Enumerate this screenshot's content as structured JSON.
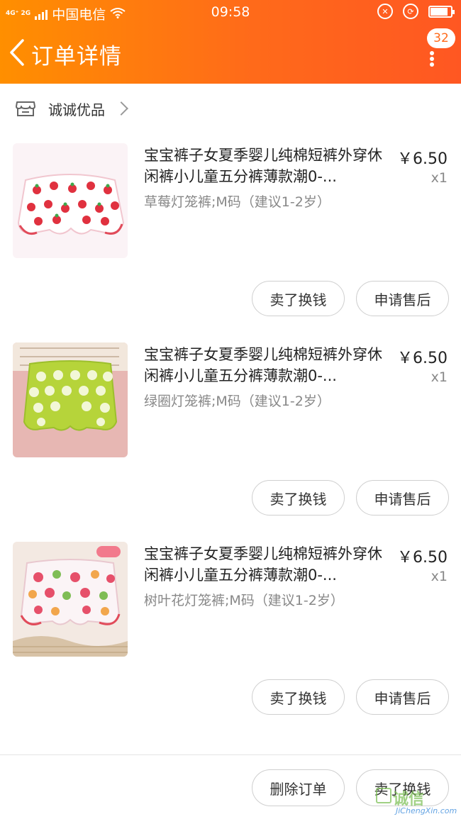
{
  "status_bar": {
    "network": "4G⁺ 2G",
    "carrier": "中国电信",
    "time": "09:58",
    "battery_level": 0.85
  },
  "nav": {
    "title": "订单详情",
    "badge_count": "32"
  },
  "shop": {
    "name": "诚诚优品"
  },
  "items": [
    {
      "name": "宝宝裤子女夏季婴儿纯棉短裤外穿休闲裤小儿童五分裤薄款潮0-...",
      "price": "￥6.50",
      "qty": "x1",
      "variant": "草莓灯笼裤;M码（建议1-2岁）",
      "sell_label": "卖了换钱",
      "aftersale_label": "申请售后"
    },
    {
      "name": "宝宝裤子女夏季婴儿纯棉短裤外穿休闲裤小儿童五分裤薄款潮0-...",
      "price": "￥6.50",
      "qty": "x1",
      "variant": "绿圈灯笼裤;M码（建议1-2岁）",
      "sell_label": "卖了换钱",
      "aftersale_label": "申请售后"
    },
    {
      "name": "宝宝裤子女夏季婴儿纯棉短裤外穿休闲裤小儿童五分裤薄款潮0-...",
      "price": "￥6.50",
      "qty": "x1",
      "variant": "树叶花灯笼裤;M码（建议1-2岁）",
      "sell_label": "卖了换钱",
      "aftersale_label": "申请售后"
    }
  ],
  "bottom_bar": {
    "delete_label": "删除订单",
    "sell_label": "卖了换钱"
  },
  "watermark": {
    "text": "诚信",
    "sub": "JiChengXin.com"
  },
  "colors": {
    "header_start": "#ff8f00",
    "header_end": "#ff5722",
    "text_secondary": "#888888"
  }
}
